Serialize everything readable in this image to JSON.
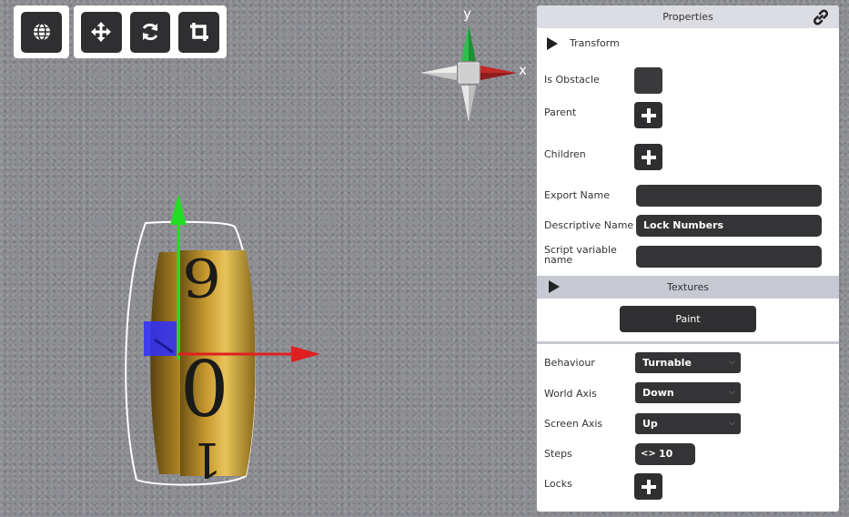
{
  "toolbar": {
    "world_icon": "globe-icon",
    "move_icon": "move-arrows-icon",
    "rotate_icon": "rotate-icon",
    "crop_icon": "crop-icon"
  },
  "gizmo": {
    "y_label": "y",
    "x_label": "x"
  },
  "properties": {
    "title": "Properties",
    "transform_label": "Transform",
    "is_obstacle_label": "Is Obstacle",
    "parent_label": "Parent",
    "children_label": "Children",
    "export_name_label": "Export Name",
    "export_name_value": "",
    "descriptive_name_label": "Descriptive Name",
    "descriptive_name_value": "Lock Numbers",
    "script_var_label_1": "Script variable",
    "script_var_label_2": "name",
    "script_var_value": "",
    "textures_label": "Textures",
    "paint_label": "Paint",
    "behaviour_label": "Behaviour",
    "behaviour_value": "Turnable",
    "world_axis_label": "World Axis",
    "world_axis_value": "Down",
    "screen_axis_label": "Screen Axis",
    "screen_axis_value": "Up",
    "steps_label": "Steps",
    "steps_value": "10",
    "locks_label": "Locks"
  },
  "object": {
    "digits": [
      "9",
      "0",
      "1"
    ]
  },
  "colors": {
    "panel_dark": "#2f2f31",
    "axis_x": "#e02020",
    "axis_y": "#22dd22",
    "handle": "#3030ff"
  }
}
